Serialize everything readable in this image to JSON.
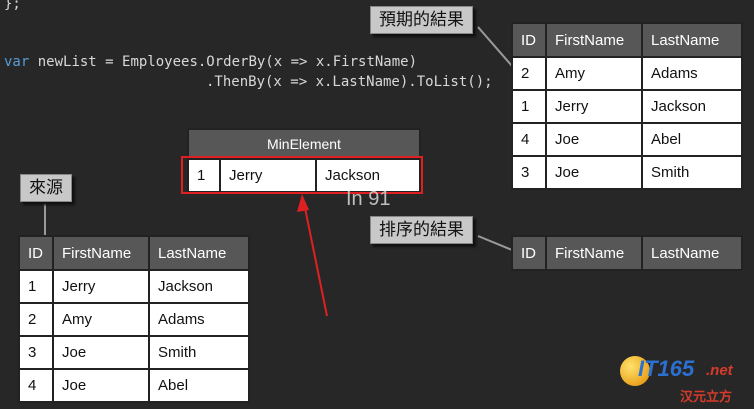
{
  "code": {
    "line0": "};",
    "line1_var": "var",
    "line1_rest": " newList = Employees.OrderBy(x => x.FirstName)",
    "line2": ".ThenBy(x => x.LastName).ToList();"
  },
  "labels": {
    "expected": "預期的結果",
    "source": "來源",
    "sorted": "排序的結果",
    "min_element": "MinElement",
    "overlay": "In 91"
  },
  "tables": {
    "expected": {
      "headers": [
        "ID",
        "FirstName",
        "LastName"
      ],
      "rows": [
        [
          "2",
          "Amy",
          "Adams"
        ],
        [
          "1",
          "Jerry",
          "Jackson"
        ],
        [
          "4",
          "Joe",
          "Abel"
        ],
        [
          "3",
          "Joe",
          "Smith"
        ]
      ]
    },
    "source": {
      "headers": [
        "ID",
        "FirstName",
        "LastName"
      ],
      "rows": [
        [
          "1",
          "Jerry",
          "Jackson"
        ],
        [
          "2",
          "Amy",
          "Adams"
        ],
        [
          "3",
          "Joe",
          "Smith"
        ],
        [
          "4",
          "Joe",
          "Abel"
        ]
      ]
    },
    "sorted": {
      "headers": [
        "ID",
        "FirstName",
        "LastName"
      ]
    },
    "min_element": {
      "row": [
        "1",
        "Jerry",
        "Jackson"
      ]
    }
  },
  "watermark": {
    "brand": "IT165",
    "suffix": ".net",
    "sub": "汉元立方"
  },
  "colors": {
    "background": "#272727",
    "header": "#575757",
    "highlight": "#e02020"
  }
}
